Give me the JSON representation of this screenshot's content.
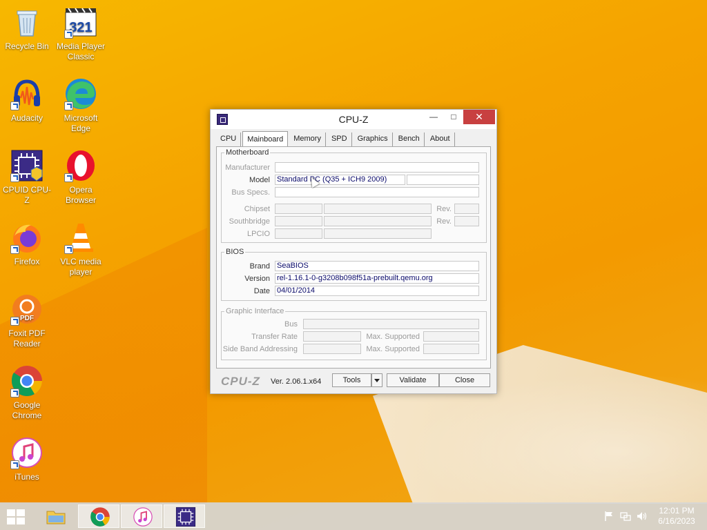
{
  "desktop": {
    "icons": [
      {
        "label": "Recycle Bin",
        "icon": "recycle-bin-icon"
      },
      {
        "label": "Media Player Classic",
        "icon": "media-player-classic-icon"
      },
      {
        "label": "Audacity",
        "icon": "audacity-icon"
      },
      {
        "label": "Microsoft Edge",
        "icon": "edge-icon"
      },
      {
        "label": "CPUID CPU-Z",
        "icon": "cpuz-icon"
      },
      {
        "label": "Opera Browser",
        "icon": "opera-icon"
      },
      {
        "label": "Firefox",
        "icon": "firefox-icon"
      },
      {
        "label": "VLC media player",
        "icon": "vlc-icon"
      },
      {
        "label": "Foxit PDF Reader",
        "icon": "foxit-icon"
      },
      {
        "label": "Google Chrome",
        "icon": "chrome-icon"
      },
      {
        "label": "iTunes",
        "icon": "itunes-icon"
      }
    ]
  },
  "window": {
    "title": "CPU-Z",
    "tabs": [
      {
        "label": "CPU"
      },
      {
        "label": "Mainboard"
      },
      {
        "label": "Memory"
      },
      {
        "label": "SPD"
      },
      {
        "label": "Graphics"
      },
      {
        "label": "Bench"
      },
      {
        "label": "About"
      }
    ],
    "active_tab": "Mainboard",
    "motherboard": {
      "legend": "Motherboard",
      "manufacturer_label": "Manufacturer",
      "manufacturer": "",
      "model_label": "Model",
      "model": "Standard PC (Q35 + ICH9 2009)",
      "bus_specs_label": "Bus Specs.",
      "chipset_label": "Chipset",
      "southbridge_label": "Southbridge",
      "lpcio_label": "LPCIO",
      "rev_label": "Rev."
    },
    "bios": {
      "legend": "BIOS",
      "brand_label": "Brand",
      "brand": "SeaBIOS",
      "version_label": "Version",
      "version": "rel-1.16.1-0-g3208b098f51a-prebuilt.qemu.org",
      "date_label": "Date",
      "date": "04/01/2014"
    },
    "graphic_interface": {
      "legend": "Graphic Interface",
      "bus_label": "Bus",
      "transfer_rate_label": "Transfer Rate",
      "side_band_label": "Side Band Addressing",
      "max_supported_label": "Max. Supported"
    },
    "footer": {
      "logo": "CPU-Z",
      "version": "Ver. 2.06.1.x64",
      "tools": "Tools",
      "validate": "Validate",
      "close": "Close"
    }
  },
  "taskbar": {
    "time": "12:01 PM",
    "date": "6/16/2023"
  },
  "colors": {
    "wallpaper": "#f5a300",
    "close_button": "#c84040",
    "value_text": "#0a0a6a"
  }
}
